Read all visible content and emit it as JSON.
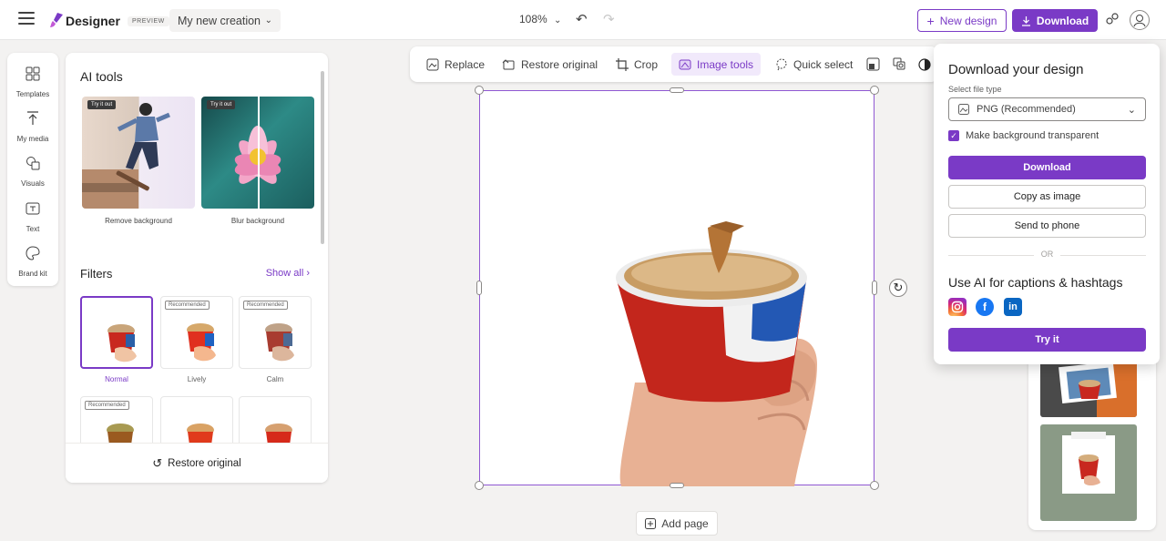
{
  "app": {
    "name": "Designer",
    "badge": "PREVIEW",
    "doc_title": "My new creation"
  },
  "header": {
    "zoom": "108%",
    "new_design": "New design",
    "download": "Download"
  },
  "rail": [
    {
      "label": "Templates"
    },
    {
      "label": "My media"
    },
    {
      "label": "Visuals"
    },
    {
      "label": "Text"
    },
    {
      "label": "Brand kit"
    }
  ],
  "panel": {
    "ai_tools_title": "AI tools",
    "try_badge": "Try it out",
    "tools": [
      {
        "label": "Remove background"
      },
      {
        "label": "Blur background"
      }
    ],
    "filters_title": "Filters",
    "show_all": "Show all",
    "recommended_badge": "Recommended",
    "filters": [
      {
        "label": "Normal"
      },
      {
        "label": "Lively"
      },
      {
        "label": "Calm"
      }
    ],
    "restore": "Restore original"
  },
  "toolbar": {
    "items": [
      {
        "label": "Replace"
      },
      {
        "label": "Restore original"
      },
      {
        "label": "Crop"
      },
      {
        "label": "Image tools"
      },
      {
        "label": "Quick select"
      }
    ]
  },
  "canvas": {
    "add_page": "Add page"
  },
  "download_popover": {
    "title": "Download your design",
    "file_type_label": "Select file type",
    "file_type_value": "PNG (Recommended)",
    "transparent_label": "Make background transparent",
    "transparent_checked": true,
    "download_btn": "Download",
    "copy_btn": "Copy as image",
    "phone_btn": "Send to phone",
    "or_text": "OR",
    "ai_title": "Use AI for captions & hashtags",
    "socials": [
      "instagram-icon",
      "facebook-icon",
      "linkedin-icon"
    ],
    "try_btn": "Try it"
  },
  "colors": {
    "accent": "#7a3ac6",
    "facebook": "#1877f2",
    "linkedin": "#0a66c2"
  }
}
